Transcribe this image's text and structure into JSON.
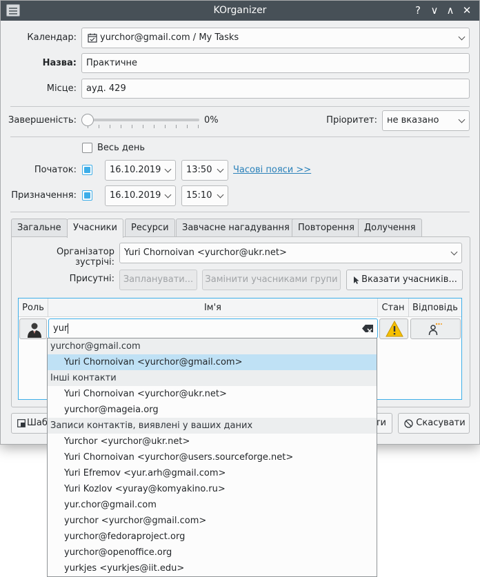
{
  "window": {
    "title": "KOrganizer",
    "help_glyph": "?",
    "minimize_glyph": "∨",
    "maximize_glyph": "∧",
    "close_glyph": "✕"
  },
  "form": {
    "calendar_label": "Календар:",
    "calendar_value": "yurchor@gmail.com / My Tasks",
    "name_label": "Назва:",
    "name_value": "Практичне",
    "place_label": "Місце:",
    "place_value": "ауд. 429",
    "completion_label": "Завершеність:",
    "completion_value": "0%",
    "completion_fraction": 0,
    "priority_label": "Пріоритет:",
    "priority_value": "не вказано",
    "allday_label": "Весь день",
    "allday_checked": false,
    "start_label": "Початок:",
    "start_checked": true,
    "start_date": "16.10.2019",
    "start_time": "13:50",
    "timezones_link": "Часові пояси >>",
    "due_label": "Призначення:",
    "due_checked": true,
    "due_date": "16.10.2019",
    "due_time": "15:10"
  },
  "tabs": [
    {
      "label": "Загальне",
      "active": false
    },
    {
      "label": "Учасники",
      "active": true
    },
    {
      "label": "Ресурси",
      "active": false
    },
    {
      "label": "Завчасне нагадування",
      "active": false
    },
    {
      "label": "Повторення",
      "active": false
    },
    {
      "label": "Долучення",
      "active": false
    }
  ],
  "attendees": {
    "organizer_label": "Організатор зустрічі:",
    "organizer_value": "Yuri Chornoivan <yurchor@ukr.net>",
    "present_label": "Присутні:",
    "schedule_button": "Запланувати...",
    "replace_group_button": "Замінити учасниками групи",
    "select_button": "Вказати учасників...",
    "columns": {
      "role": "Роль",
      "name": "Ім'я",
      "status": "Стан",
      "response": "Відповідь"
    },
    "name_input_value": "yur"
  },
  "footer": {
    "templates_button": "Шаб",
    "ok_button_fragment": "ти",
    "cancel_button": "Скасувати"
  },
  "autocomplete": {
    "rows": [
      {
        "type": "header",
        "text": "yurchor@gmail.com"
      },
      {
        "type": "item",
        "text": "Yuri Chornoivan <yurchor@gmail.com>",
        "selected": true
      },
      {
        "type": "header",
        "text": "Інші контакти"
      },
      {
        "type": "item",
        "text": "Yuri Chornoivan <yurchor@ukr.net>"
      },
      {
        "type": "item",
        "text": "yurchor@mageia.org"
      },
      {
        "type": "header",
        "text": "Записи контактів, виявлені у ваших даних"
      },
      {
        "type": "item",
        "text": "Yurchor <yurchor@ukr.net>"
      },
      {
        "type": "item",
        "text": "Yuri Chornoivan <yurchor@users.sourceforge.net>"
      },
      {
        "type": "item",
        "text": "Yuri Efremov <yur.arh@gmail.com>"
      },
      {
        "type": "item",
        "text": "Yuri Kozlov <yuray@komyakino.ru>"
      },
      {
        "type": "item",
        "text": "yur.chor@gmail.com"
      },
      {
        "type": "item",
        "text": "yurchor <yurchor@gmail.com>"
      },
      {
        "type": "item",
        "text": "yurchor@fedoraproject.org"
      },
      {
        "type": "item",
        "text": "yurchor@openoffice.org"
      },
      {
        "type": "item",
        "text": "yurkjes <yurkjes@iit.edu>"
      }
    ]
  },
  "colors": {
    "accent": "#3daee9",
    "titlebar": "#475057",
    "link": "#2980b9",
    "selection": "#bfe1f5",
    "warning": "#f6c000"
  }
}
